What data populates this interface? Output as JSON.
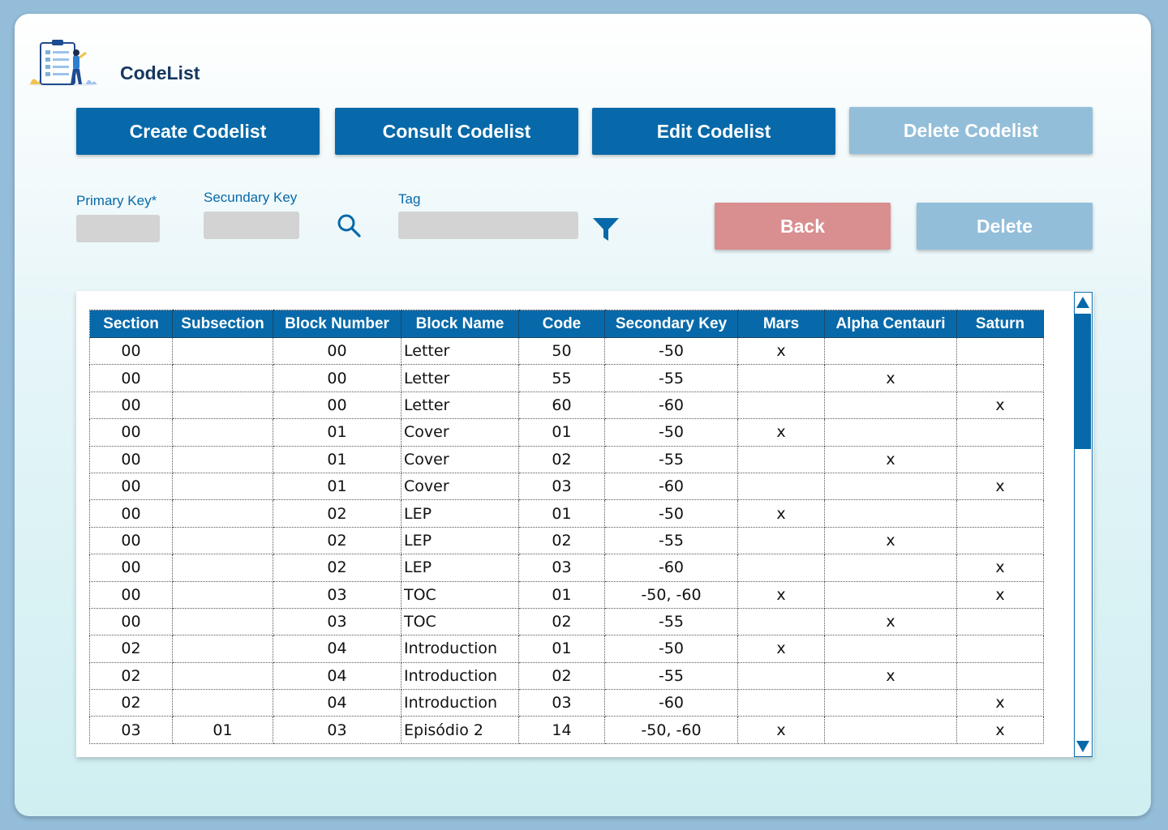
{
  "app": {
    "title": "CodeList"
  },
  "top_actions": {
    "create": "Create Codelist",
    "consult": "Consult Codelist",
    "edit": "Edit Codelist",
    "delete": "Delete Codelist"
  },
  "filters": {
    "primary_key_label": "Primary Key*",
    "primary_key_value": "",
    "secondary_key_label": "Secundary Key",
    "secondary_key_value": "",
    "tag_label": "Tag",
    "tag_value": ""
  },
  "actions": {
    "back": "Back",
    "delete": "Delete"
  },
  "colors": {
    "primary": "#0769a9",
    "disabled": "#93bed9",
    "back": "#d98e8f",
    "title": "#17375e"
  },
  "icons": [
    "clipboard-logo-icon",
    "search-icon",
    "filter-icon",
    "scroll-up-icon",
    "scroll-down-icon"
  ],
  "table": {
    "headers": [
      "Section",
      "Subsection",
      "Block Number",
      "Block Name",
      "Code",
      "Secondary Key",
      "Mars",
      "Alpha Centauri",
      "Saturn"
    ],
    "rows": [
      [
        "00",
        "",
        "00",
        "Letter",
        "50",
        "-50",
        "x",
        "",
        ""
      ],
      [
        "00",
        "",
        "00",
        "Letter",
        "55",
        "-55",
        "",
        "x",
        ""
      ],
      [
        "00",
        "",
        "00",
        "Letter",
        "60",
        "-60",
        "",
        "",
        "x"
      ],
      [
        "00",
        "",
        "01",
        "Cover",
        "01",
        "-50",
        "x",
        "",
        ""
      ],
      [
        "00",
        "",
        "01",
        "Cover",
        "02",
        "-55",
        "",
        "x",
        ""
      ],
      [
        "00",
        "",
        "01",
        "Cover",
        "03",
        "-60",
        "",
        "",
        "x"
      ],
      [
        "00",
        "",
        "02",
        "LEP",
        "01",
        "-50",
        "x",
        "",
        ""
      ],
      [
        "00",
        "",
        "02",
        "LEP",
        "02",
        "-55",
        "",
        "x",
        ""
      ],
      [
        "00",
        "",
        "02",
        "LEP",
        "03",
        "-60",
        "",
        "",
        "x"
      ],
      [
        "00",
        "",
        "03",
        "TOC",
        "01",
        "-50, -60",
        "x",
        "",
        "x"
      ],
      [
        "00",
        "",
        "03",
        "TOC",
        "02",
        "-55",
        "",
        "x",
        ""
      ],
      [
        "02",
        "",
        "04",
        "Introduction",
        "01",
        "-50",
        "x",
        "",
        ""
      ],
      [
        "02",
        "",
        "04",
        "Introduction",
        "02",
        "-55",
        "",
        "x",
        ""
      ],
      [
        "02",
        "",
        "04",
        "Introduction",
        "03",
        "-60",
        "",
        "",
        "x"
      ],
      [
        "03",
        "01",
        "03",
        "Episódio 2",
        "14",
        "-50, -60",
        "x",
        "",
        "x"
      ]
    ]
  },
  "scroll": {
    "position": 0.0,
    "visible_fraction": 0.32
  }
}
